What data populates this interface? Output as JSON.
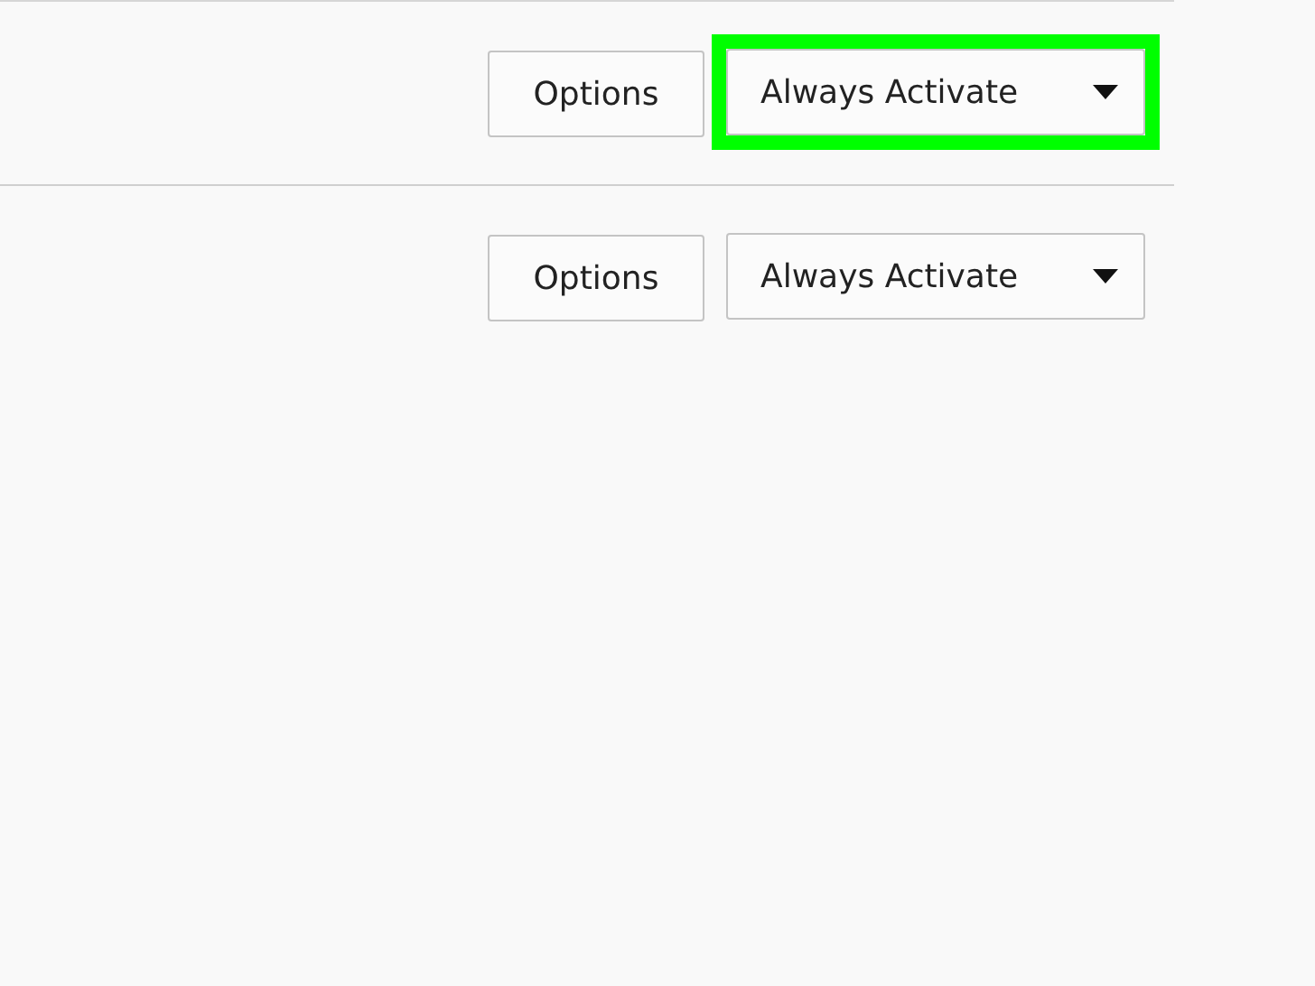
{
  "rows": [
    {
      "button": "Options",
      "dropdown": {
        "value": "Always Activate",
        "highlighted": true
      }
    },
    {
      "button": "Options",
      "dropdown": {
        "value": "Always Activate",
        "highlighted": false
      }
    }
  ]
}
